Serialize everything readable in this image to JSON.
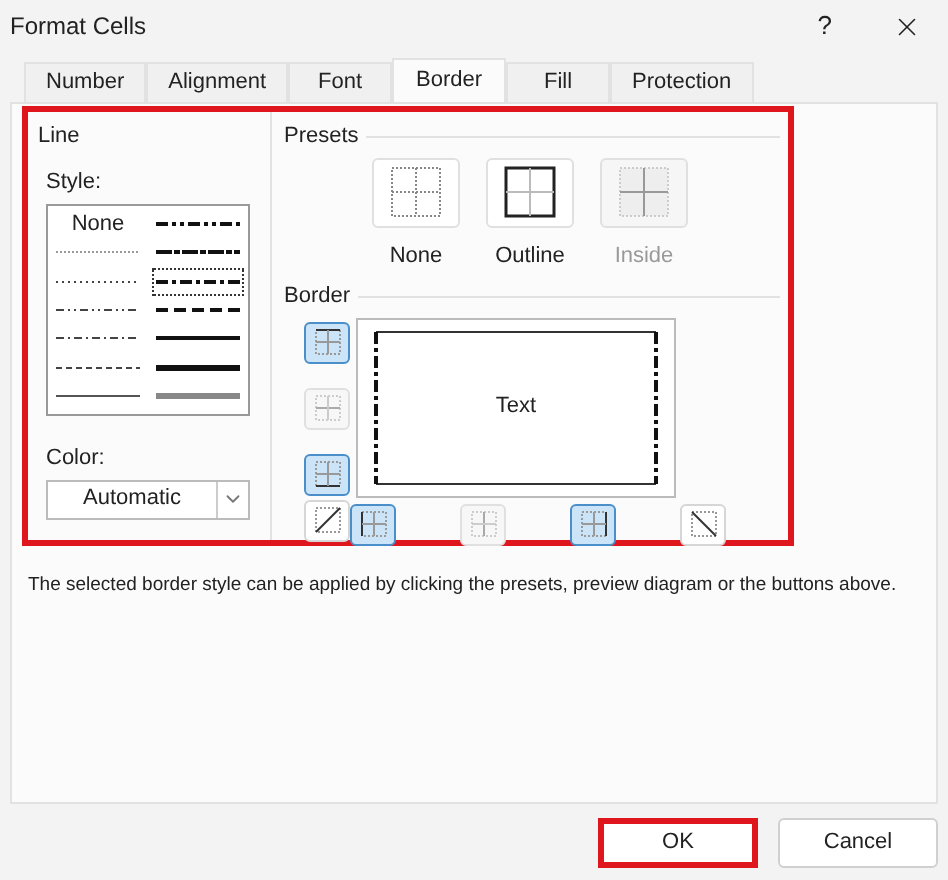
{
  "window": {
    "title": "Format Cells",
    "help": "?"
  },
  "tabs": [
    {
      "label": "Number",
      "selected": false
    },
    {
      "label": "Alignment",
      "selected": false
    },
    {
      "label": "Font",
      "selected": false
    },
    {
      "label": "Border",
      "selected": true
    },
    {
      "label": "Fill",
      "selected": false
    },
    {
      "label": "Protection",
      "selected": false
    }
  ],
  "line": {
    "title": "Line",
    "highlighted": true,
    "style_label": "Style:",
    "styles": [
      {
        "kind": "none",
        "label": "None",
        "selected": false
      },
      {
        "kind": "mediumdashdotdot",
        "selected": false
      },
      {
        "kind": "hair",
        "selected": false
      },
      {
        "kind": "slanted",
        "selected": false
      },
      {
        "kind": "dotted",
        "selected": false
      },
      {
        "kind": "mediumdashdot",
        "selected": true
      },
      {
        "kind": "dashdotdot",
        "selected": false
      },
      {
        "kind": "mediumdashed",
        "selected": false
      },
      {
        "kind": "dashdot",
        "selected": false
      },
      {
        "kind": "medium",
        "selected": false
      },
      {
        "kind": "dashed",
        "selected": false
      },
      {
        "kind": "thick",
        "selected": false
      },
      {
        "kind": "thin",
        "selected": false
      },
      {
        "kind": "double",
        "selected": false
      }
    ],
    "color_label": "Color:",
    "color_value": "Automatic"
  },
  "presets": {
    "title": "Presets",
    "items": [
      {
        "kind": "none",
        "label": "None",
        "disabled": false
      },
      {
        "kind": "outline",
        "label": "Outline",
        "disabled": false
      },
      {
        "kind": "inside",
        "label": "Inside",
        "disabled": true
      }
    ]
  },
  "border": {
    "title": "Border",
    "preview_text": "Text",
    "side_buttons": [
      {
        "kind": "top",
        "selected": true,
        "disabled": false
      },
      {
        "kind": "middle",
        "selected": false,
        "disabled": true
      },
      {
        "kind": "bottom",
        "selected": true,
        "disabled": false
      },
      {
        "kind": "diagup",
        "selected": false,
        "disabled": false
      }
    ],
    "bottom_buttons": [
      {
        "kind": "left",
        "selected": true,
        "disabled": false
      },
      {
        "kind": "center",
        "selected": false,
        "disabled": true
      },
      {
        "kind": "right",
        "selected": true,
        "disabled": false
      },
      {
        "kind": "diagdown",
        "selected": false,
        "disabled": false
      }
    ]
  },
  "description": "The selected border style can be applied by clicking the presets, preview diagram or the buttons above.",
  "buttons": [
    {
      "label": "OK",
      "highlighted": true
    },
    {
      "label": "Cancel",
      "highlighted": false
    }
  ]
}
